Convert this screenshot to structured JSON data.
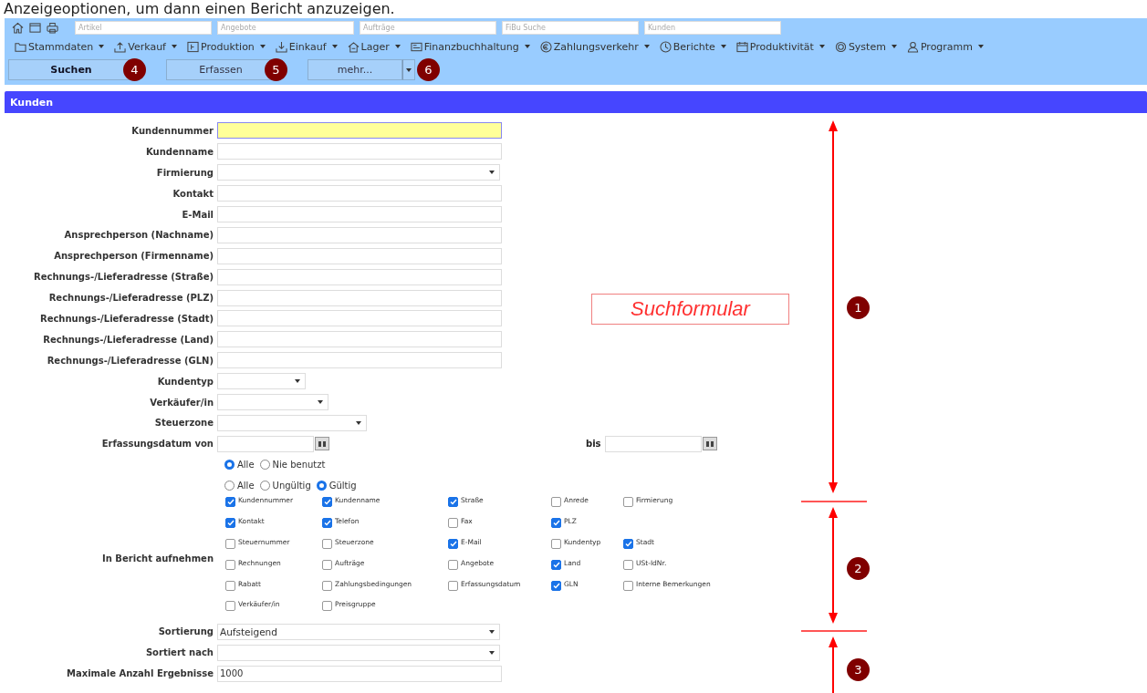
{
  "caption": "Anzeigeoptionen, um dann einen Bericht anzuzeigen.",
  "toolbar": {
    "quick_search": [
      {
        "placeholder": "Artikel"
      },
      {
        "placeholder": "Angebote"
      },
      {
        "placeholder": "Aufträge"
      },
      {
        "placeholder": "FiBu Suche"
      },
      {
        "placeholder": "Kunden"
      }
    ],
    "menus": [
      {
        "label": "Stammdaten"
      },
      {
        "label": "Verkauf"
      },
      {
        "label": "Produktion"
      },
      {
        "label": "Einkauf"
      },
      {
        "label": "Lager"
      },
      {
        "label": "Finanzbuchhaltung"
      },
      {
        "label": "Zahlungsverkehr"
      },
      {
        "label": "Berichte"
      },
      {
        "label": "Produktivität"
      },
      {
        "label": "System"
      },
      {
        "label": "Programm"
      }
    ],
    "buttons": [
      {
        "label": "Suchen",
        "primary": true,
        "dropdown": false,
        "callout": "4"
      },
      {
        "label": "Erfassen",
        "primary": false,
        "dropdown": false,
        "callout": "5"
      },
      {
        "label": "mehr...",
        "primary": false,
        "dropdown": true,
        "callout": "6"
      }
    ]
  },
  "panel_title": "Kunden",
  "fields": [
    {
      "kind": "text",
      "label": "Kundennummer",
      "focused": true
    },
    {
      "kind": "text",
      "label": "Kundenname",
      "focused": false
    },
    {
      "kind": "select",
      "label": "Firmierung"
    },
    {
      "kind": "text",
      "label": "Kontakt",
      "focused": false
    },
    {
      "kind": "text",
      "label": "E-Mail",
      "focused": false
    },
    {
      "kind": "text",
      "label": "Ansprechperson (Nachname)",
      "focused": false
    },
    {
      "kind": "text",
      "label": "Ansprechperson (Firmenname)",
      "focused": false
    },
    {
      "kind": "text",
      "label": "Rechnungs-/Lieferadresse (Straße)",
      "focused": false
    },
    {
      "kind": "text",
      "label": "Rechnungs-/Lieferadresse (PLZ)",
      "focused": false
    },
    {
      "kind": "text",
      "label": "Rechnungs-/Lieferadresse (Stadt)",
      "focused": false
    },
    {
      "kind": "text",
      "label": "Rechnungs-/Lieferadresse (Land)",
      "focused": false
    },
    {
      "kind": "text",
      "label": "Rechnungs-/Lieferadresse (GLN)",
      "focused": false
    },
    {
      "kind": "short_select",
      "label": "Kundentyp"
    },
    {
      "kind": "medium_select",
      "label": "Verkäufer/in"
    },
    {
      "kind": "long_select",
      "label": "Steuerzone"
    },
    {
      "kind": "date_range",
      "label": "Erfassungsdatum von",
      "to_label": "bis"
    },
    {
      "kind": "radio",
      "options": [
        {
          "label": "Alle",
          "selected": true
        },
        {
          "label": "Nie benutzt",
          "selected": false
        }
      ]
    },
    {
      "kind": "radio",
      "options": [
        {
          "label": "Alle",
          "selected": false
        },
        {
          "label": "Ungültig",
          "selected": false
        },
        {
          "label": "Gültig",
          "selected": true
        }
      ]
    },
    {
      "kind": "checkboxes",
      "label": "In Bericht aufnehmen",
      "rows": [
        [
          {
            "label": "Kundennummer",
            "checked": true
          },
          {
            "label": "Kundenname",
            "checked": true
          },
          {
            "label": "Straße",
            "checked": true
          },
          {
            "label": "Anrede",
            "checked": false
          },
          {
            "label": "Firmierung",
            "checked": false
          }
        ],
        [
          {
            "label": "Kontakt",
            "checked": true
          },
          {
            "label": "Telefon",
            "checked": true
          },
          {
            "label": "Fax",
            "checked": false
          },
          {
            "label": "PLZ",
            "checked": true
          }
        ],
        [
          {
            "label": "Steuernummer",
            "checked": false
          },
          {
            "label": "Steuerzone",
            "checked": false
          },
          {
            "label": "E-Mail",
            "checked": true
          },
          {
            "label": "Kundentyp",
            "checked": false
          },
          {
            "label": "Stadt",
            "checked": true
          }
        ],
        [
          {
            "label": "Rechnungen",
            "checked": false
          },
          {
            "label": "Aufträge",
            "checked": false
          },
          {
            "label": "Angebote",
            "checked": false
          },
          {
            "label": "Land",
            "checked": true
          },
          {
            "label": "USt-IdNr.",
            "checked": false
          }
        ],
        [
          {
            "label": "Rabatt",
            "checked": false
          },
          {
            "label": "Zahlungsbedingungen",
            "checked": false
          },
          {
            "label": "Erfassungsdatum",
            "checked": false
          },
          {
            "label": "GLN",
            "checked": true
          },
          {
            "label": "Interne Bemerkungen",
            "checked": false
          }
        ],
        [
          {
            "label": "Verkäufer/in",
            "checked": false
          },
          {
            "label": "Preisgruppe",
            "checked": false
          }
        ]
      ]
    },
    {
      "kind": "select",
      "label": "Sortierung",
      "value": "Aufsteigend"
    },
    {
      "kind": "select",
      "label": "Sortiert nach"
    },
    {
      "kind": "text",
      "label": "Maximale Anzahl Ergebnisse",
      "focused": false,
      "value": "1000"
    }
  ],
  "annotations": {
    "label": "Suchformular",
    "sections": [
      "1",
      "2",
      "3"
    ]
  }
}
